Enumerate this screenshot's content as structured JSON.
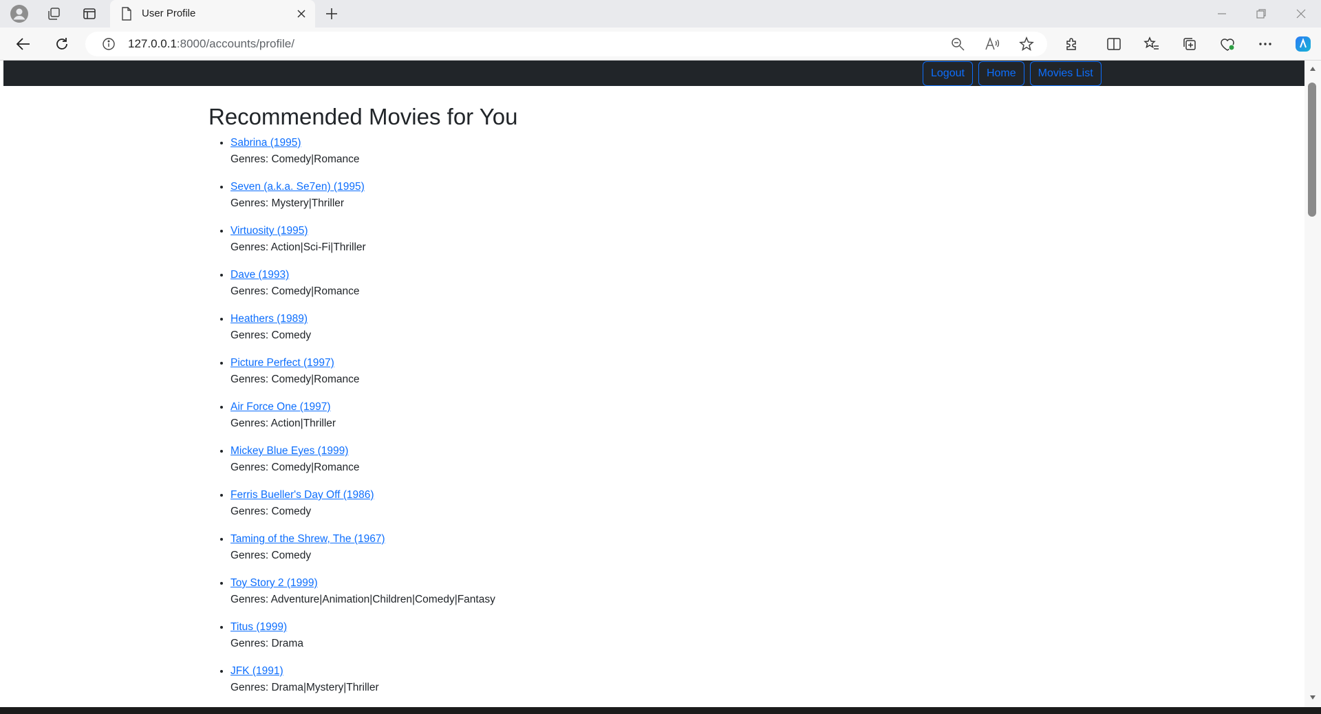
{
  "browser": {
    "tab_title": "User Profile",
    "url_host": "127.0.0.1",
    "url_path": ":8000/accounts/profile/"
  },
  "navbar": {
    "logout_label": "Logout",
    "home_label": "Home",
    "movies_list_label": "Movies List"
  },
  "page": {
    "title": "Recommended Movies for You",
    "genres_prefix": "Genres: ",
    "movies": [
      {
        "title": "Sabrina (1995)",
        "genres": "Genres: Comedy|Romance"
      },
      {
        "title": "Seven (a.k.a. Se7en) (1995)",
        "genres": "Genres: Mystery|Thriller"
      },
      {
        "title": "Virtuosity (1995)",
        "genres": "Genres: Action|Sci-Fi|Thriller"
      },
      {
        "title": "Dave (1993)",
        "genres": "Genres: Comedy|Romance"
      },
      {
        "title": "Heathers (1989)",
        "genres": "Genres: Comedy"
      },
      {
        "title": "Picture Perfect (1997)",
        "genres": "Genres: Comedy|Romance"
      },
      {
        "title": "Air Force One (1997)",
        "genres": "Genres: Action|Thriller"
      },
      {
        "title": "Mickey Blue Eyes (1999)",
        "genres": "Genres: Comedy|Romance"
      },
      {
        "title": "Ferris Bueller's Day Off (1986)",
        "genres": "Genres: Comedy"
      },
      {
        "title": "Taming of the Shrew, The (1967)",
        "genres": "Genres: Comedy"
      },
      {
        "title": "Toy Story 2 (1999)",
        "genres": "Genres: Adventure|Animation|Children|Comedy|Fantasy"
      },
      {
        "title": "Titus (1999)",
        "genres": "Genres: Drama"
      },
      {
        "title": "JFK (1991)",
        "genres": "Genres: Drama|Mystery|Thriller"
      }
    ]
  },
  "colors": {
    "navbar_bg": "#212529",
    "link": "#0d6efd"
  }
}
